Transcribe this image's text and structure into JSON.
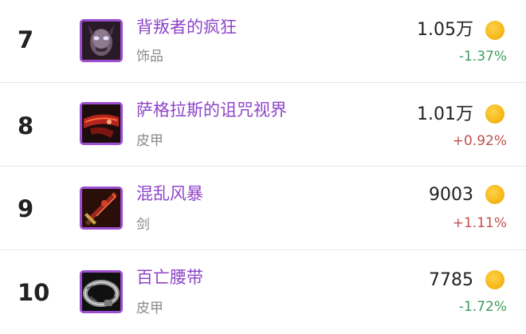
{
  "colors": {
    "item_name": "#8e44c8",
    "icon_border": "#9b4ecf",
    "category": "#8a8a8a",
    "change_up": "#c0504d",
    "change_down": "#3f9b5d",
    "coin": "#f6b81a"
  },
  "items": [
    {
      "rank": "7",
      "name": "背叛者的疯狂",
      "category": "饰品",
      "price": "1.05万",
      "change": "-1.37%",
      "trend": "down",
      "icon": "betrayer-skull-icon"
    },
    {
      "rank": "8",
      "name": "萨格拉斯的诅咒视界",
      "category": "皮甲",
      "price": "1.01万",
      "change": "+0.92%",
      "trend": "up",
      "icon": "red-blindfold-icon"
    },
    {
      "rank": "9",
      "name": "混乱风暴",
      "category": "剑",
      "price": "9003",
      "change": "+1.11%",
      "trend": "up",
      "icon": "chaos-sword-icon"
    },
    {
      "rank": "10",
      "name": "百亡腰带",
      "category": "皮甲",
      "price": "7785",
      "change": "-1.72%",
      "trend": "down",
      "icon": "belt-icon"
    }
  ]
}
